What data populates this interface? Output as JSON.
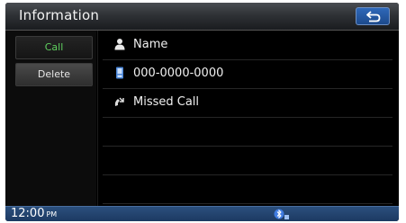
{
  "header": {
    "title": "Information",
    "back_icon": "back-arrow-icon"
  },
  "sidebar": {
    "call_label": "Call",
    "delete_label": "Delete"
  },
  "detail": {
    "rows": [
      {
        "icon": "person-icon",
        "text": "Name"
      },
      {
        "icon": "mobile-phone-icon",
        "text": "000-0000-0000"
      },
      {
        "icon": "missed-call-icon",
        "text": "Missed Call"
      },
      {
        "icon": "",
        "text": ""
      },
      {
        "icon": "",
        "text": ""
      },
      {
        "icon": "",
        "text": ""
      }
    ]
  },
  "status": {
    "time": "12:00",
    "ampm": "PM",
    "icon": "bluetooth-phone-icon"
  },
  "colors": {
    "accent_blue": "#2f68b9",
    "call_green": "#5fd05f",
    "status_bar": "#1b3860"
  }
}
